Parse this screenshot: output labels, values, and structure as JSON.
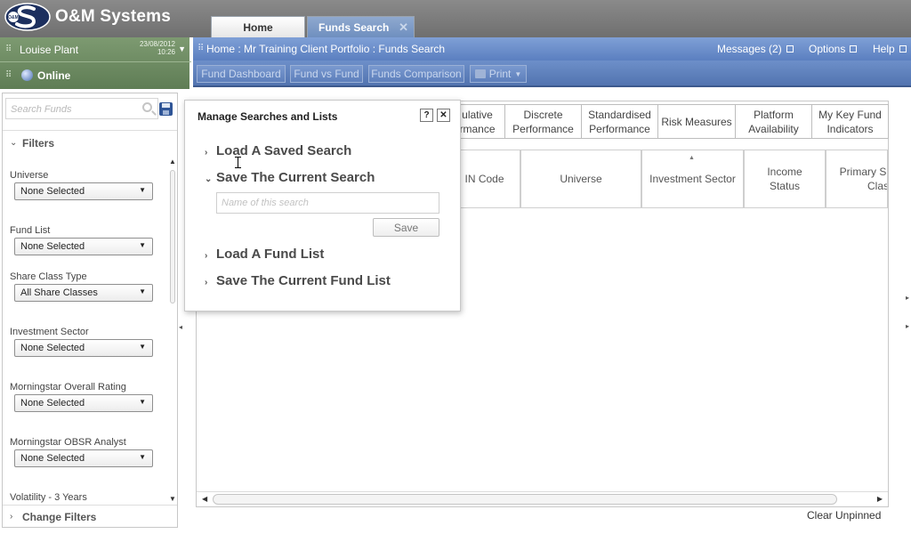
{
  "app": {
    "brand": "O&M Systems",
    "logo_text": "O&M"
  },
  "tabs": [
    {
      "label": "Home"
    },
    {
      "label": "Funds Search",
      "close": "✕"
    }
  ],
  "user": {
    "name": "Louise Plant",
    "date": "23/08/2012",
    "time": "10:26",
    "status": "Online"
  },
  "breadcrumb": "Home : Mr Training Client Portfolio : Funds Search",
  "top_nav": {
    "messages": "Messages (2)",
    "options": "Options",
    "help": "Help"
  },
  "toolbar": {
    "dashboard": "Fund Dashboard",
    "fund_vs_fund": "Fund vs Fund",
    "comparison": "Funds Comparison",
    "print": "Print"
  },
  "left_panel": {
    "search_placeholder": "Search Funds",
    "filters_title": "Filters",
    "filters": [
      {
        "label": "Universe",
        "value": "None Selected"
      },
      {
        "label": "Fund List",
        "value": "None Selected"
      },
      {
        "label": "Share Class Type",
        "value": "All Share Classes"
      },
      {
        "label": "Investment Sector",
        "value": "None Selected"
      },
      {
        "label": "Morningstar Overall Rating",
        "value": "None Selected"
      },
      {
        "label": "Morningstar OBSR Analyst",
        "value": "None Selected"
      },
      {
        "label": "Volatility - 3 Years"
      }
    ],
    "change_filters": "Change Filters"
  },
  "category_tabs": [
    {
      "line1": "ulative",
      "line2": "rmance"
    },
    {
      "line1": "Discrete",
      "line2": "Performance"
    },
    {
      "line1": "Standardised",
      "line2": "Performance"
    },
    {
      "line1": "Risk Measures"
    },
    {
      "line1": "Platform",
      "line2": "Availability"
    },
    {
      "line1": "My Key Fund",
      "line2": "Indicators"
    }
  ],
  "columns": [
    {
      "line1": "IN Code"
    },
    {
      "line1": "Universe"
    },
    {
      "line1": "Investment Sector"
    },
    {
      "line1": "Income",
      "line2": "Status"
    },
    {
      "line1": "Primary S",
      "line2": "Class"
    }
  ],
  "footer": {
    "clear_unpinned": "Clear Unpinned"
  },
  "popup": {
    "title": "Manage Searches and Lists",
    "help": "?",
    "close": "✕",
    "load_saved_search": "Load A Saved Search",
    "save_current_search": "Save The Current Search",
    "name_placeholder": "Name of this search",
    "save_button": "Save",
    "load_fund_list": "Load A Fund List",
    "save_fund_list": "Save The Current Fund List"
  }
}
